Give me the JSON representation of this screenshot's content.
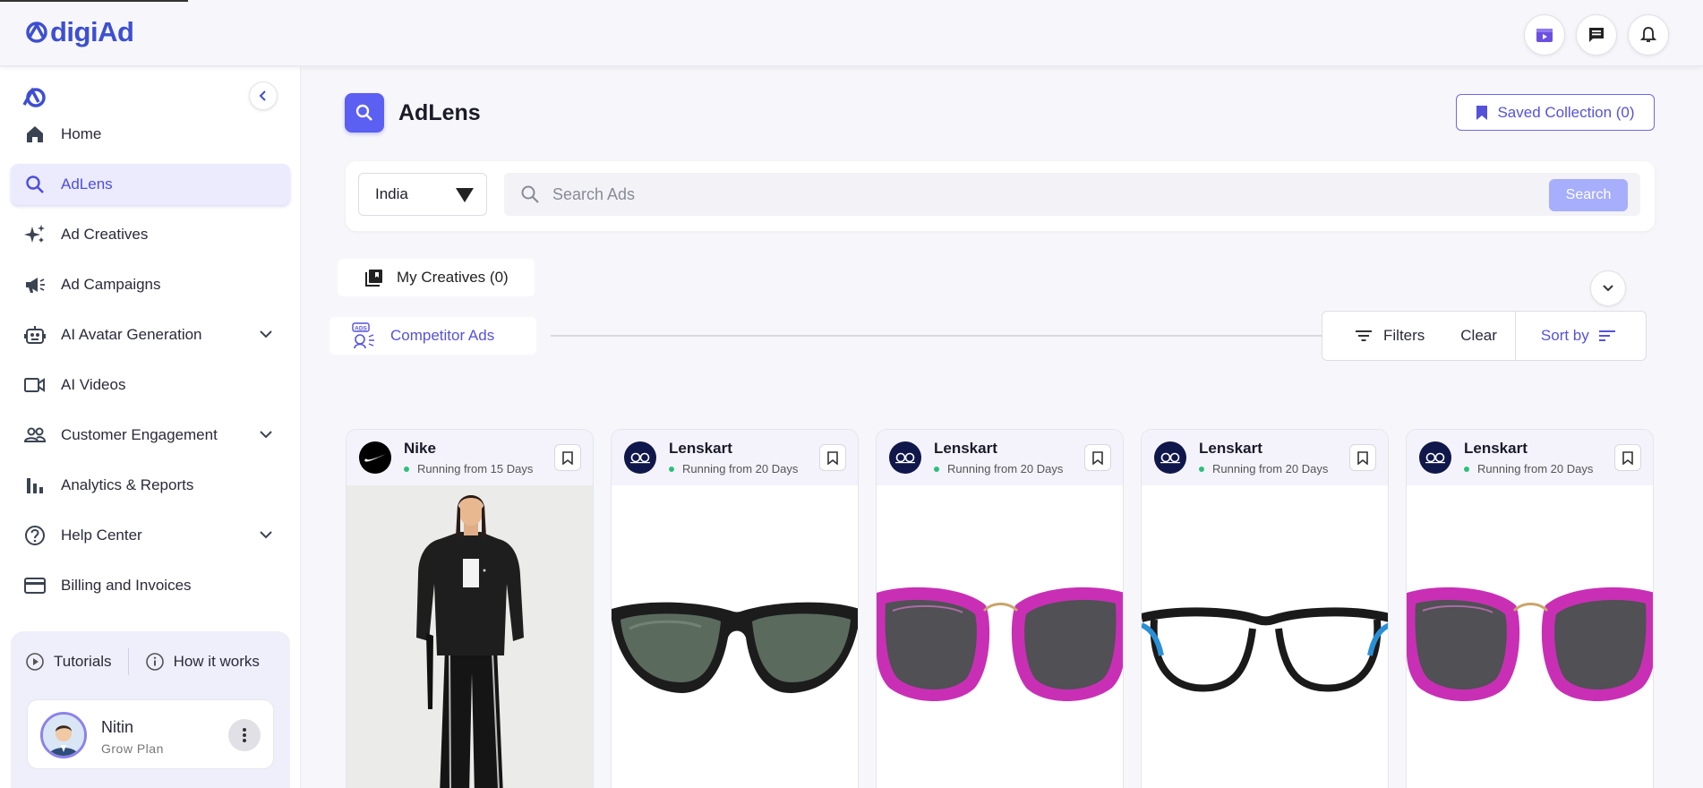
{
  "app": {
    "logo_text": "digiAd"
  },
  "topbar": {
    "icons": [
      "video-icon",
      "chat-icon",
      "bell-icon"
    ]
  },
  "sidebar": {
    "items": [
      {
        "label": "Home",
        "icon": "home-icon",
        "active": false,
        "expandable": false
      },
      {
        "label": "AdLens",
        "icon": "search-icon",
        "active": true,
        "expandable": false
      },
      {
        "label": "Ad Creatives",
        "icon": "sparkle-icon",
        "active": false,
        "expandable": false
      },
      {
        "label": "Ad Campaigns",
        "icon": "megaphone-icon",
        "active": false,
        "expandable": false
      },
      {
        "label": "AI Avatar Generation",
        "icon": "robot-icon",
        "active": false,
        "expandable": true
      },
      {
        "label": "AI Videos",
        "icon": "video-camera-icon",
        "active": false,
        "expandable": false
      },
      {
        "label": "Customer Engagement",
        "icon": "people-icon",
        "active": false,
        "expandable": true
      },
      {
        "label": "Analytics & Reports",
        "icon": "bar-chart-icon",
        "active": false,
        "expandable": false
      },
      {
        "label": "Help Center",
        "icon": "help-icon",
        "active": false,
        "expandable": true
      },
      {
        "label": "Billing and Invoices",
        "icon": "card-icon",
        "active": false,
        "expandable": false
      }
    ],
    "tutorials_label": "Tutorials",
    "how_it_works_label": "How it works",
    "user": {
      "name": "Nitin",
      "plan": "Grow Plan"
    }
  },
  "main": {
    "title": "AdLens",
    "saved_collection_label": "Saved Collection (0)",
    "country": "India",
    "search_placeholder": "Search Ads",
    "search_button": "Search",
    "my_creatives_label": "My Creatives (0)",
    "competitor_ads_label": "Competitor Ads",
    "filters_label": "Filters",
    "clear_label": "Clear",
    "sort_label": "Sort by"
  },
  "cards": [
    {
      "brand": "Nike",
      "running": "Running from 15 Days",
      "image": "model-jacket"
    },
    {
      "brand": "Lenskart",
      "running": "Running from 20 Days",
      "image": "black-sunglasses"
    },
    {
      "brand": "Lenskart",
      "running": "Running from 20 Days",
      "image": "pink-sunglasses"
    },
    {
      "brand": "Lenskart",
      "running": "Running from 20 Days",
      "image": "black-blue-eyeglasses"
    },
    {
      "brand": "Lenskart",
      "running": "Running from 20 Days",
      "image": "pink-sunglasses"
    }
  ]
}
